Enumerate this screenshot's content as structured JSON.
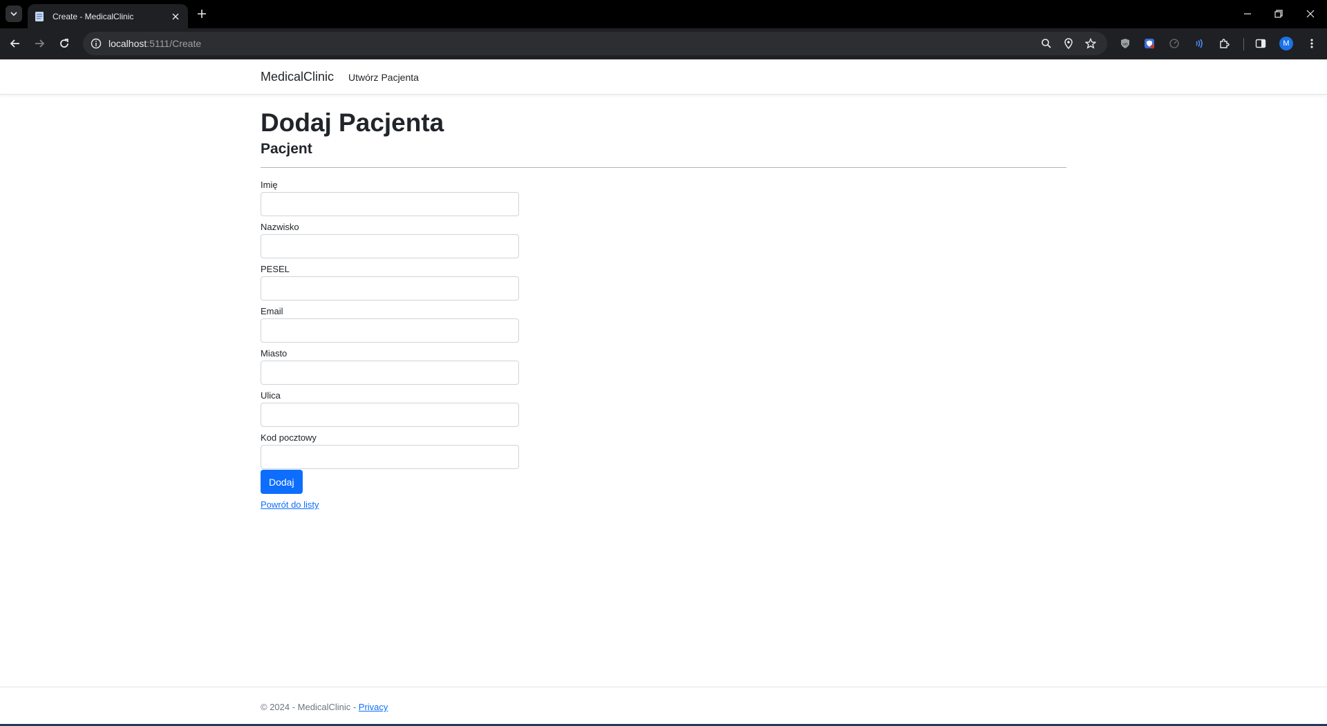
{
  "browser": {
    "tab_title": "Create - MedicalClinic",
    "url_host": "localhost",
    "url_rest": ":5111/Create",
    "profile_initial": "M"
  },
  "navbar": {
    "brand": "MedicalClinic",
    "link_create": "Utwórz Pacjenta"
  },
  "main": {
    "title": "Dodaj Pacjenta",
    "subtitle": "Pacjent",
    "fields": [
      {
        "label": "Imię",
        "value": ""
      },
      {
        "label": "Nazwisko",
        "value": ""
      },
      {
        "label": "PESEL",
        "value": ""
      },
      {
        "label": "Email",
        "value": ""
      },
      {
        "label": "Miasto",
        "value": ""
      },
      {
        "label": "Ulica",
        "value": ""
      },
      {
        "label": "Kod pocztowy",
        "value": ""
      }
    ],
    "submit_label": "Dodaj",
    "back_link": "Powrót do listy"
  },
  "footer": {
    "text": "© 2024 - MedicalClinic - ",
    "privacy_link": "Privacy"
  },
  "colors": {
    "primary": "#0d6efd",
    "text": "#212529",
    "muted": "#6c757d"
  }
}
